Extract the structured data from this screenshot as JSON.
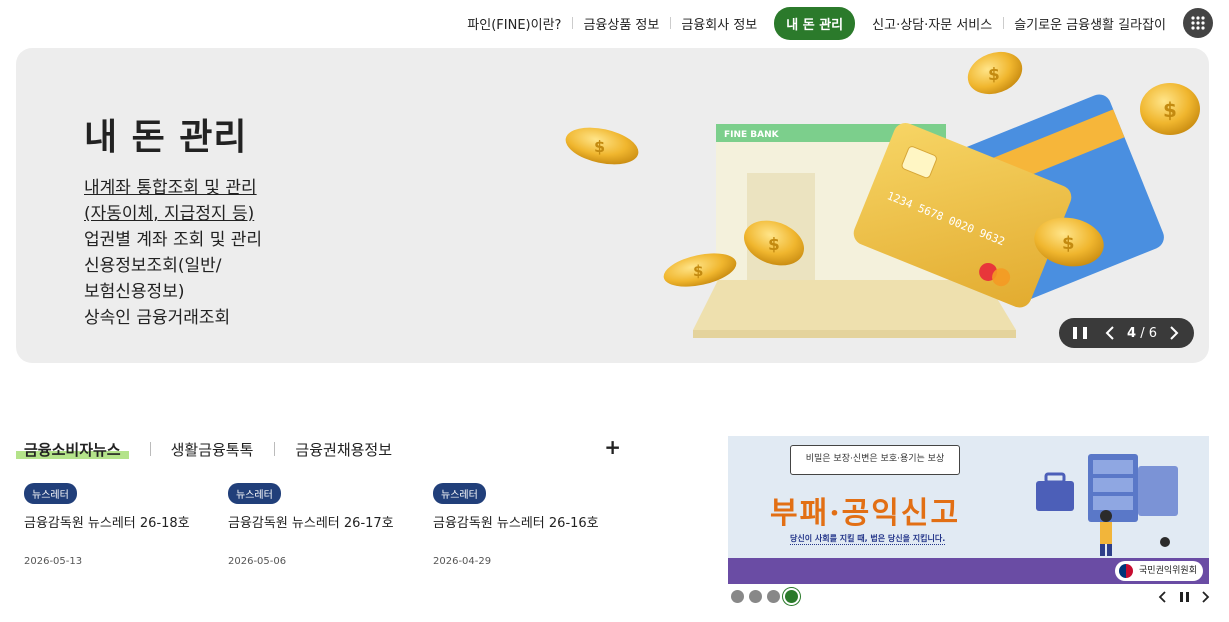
{
  "topnav": {
    "items": [
      {
        "label": "파인(FINE)이란?"
      },
      {
        "label": "금융상품 정보"
      },
      {
        "label": "금융회사 정보"
      },
      {
        "label": "내 돈 관리",
        "active": true
      },
      {
        "label": "신고·상담·자문 서비스"
      },
      {
        "label": "슬기로운 금융생활 길라잡이"
      }
    ],
    "menu_icon": "grid-menu-icon"
  },
  "hero": {
    "title": "내 돈 관리",
    "items": [
      {
        "text": "내계좌 통합조회 및 관리",
        "link": true
      },
      {
        "text": "(자동이체, 지급정지 등)",
        "link": true
      },
      {
        "text": "업권별 계좌 조회 및 관리",
        "link": false
      },
      {
        "text": "신용정보조회(일반/",
        "link": false
      },
      {
        "text": "보험신용정보)",
        "link": false
      },
      {
        "text": "상속인 금융거래조회",
        "link": false
      }
    ],
    "art": {
      "window_label": "FINE BANK",
      "card_number": "1234 5678 0020 9632",
      "colors": {
        "green": "#7ccf8c",
        "card_gold": "#f1c44b",
        "card_blue": "#4a8fe0"
      }
    },
    "slider": {
      "current": "4",
      "separator": "/",
      "total": "6"
    }
  },
  "news": {
    "tabs": [
      {
        "label": "금융소비자뉴스",
        "active": true
      },
      {
        "label": "생활금융톡톡"
      },
      {
        "label": "금융권채용정보"
      }
    ],
    "more_label": "+",
    "items": [
      {
        "badge": "뉴스레터",
        "title": "금융감독원 뉴스레터 26-18호",
        "date": "2026-05-13"
      },
      {
        "badge": "뉴스레터",
        "title": "금융감독원 뉴스레터 26-17호",
        "date": "2026-05-06"
      },
      {
        "badge": "뉴스레터",
        "title": "금융감독원 뉴스레터 26-16호",
        "date": "2026-04-29"
      }
    ]
  },
  "banner": {
    "quote": "비밀은 보장·신변은 보호·용기는 보상",
    "main": "부패·공익신고",
    "sub": "당신이 사회를 지킬 때, 법은 당신을 지킵니다.",
    "org": "국민권익위원회",
    "dots_total": 4,
    "dots_active": 4
  }
}
